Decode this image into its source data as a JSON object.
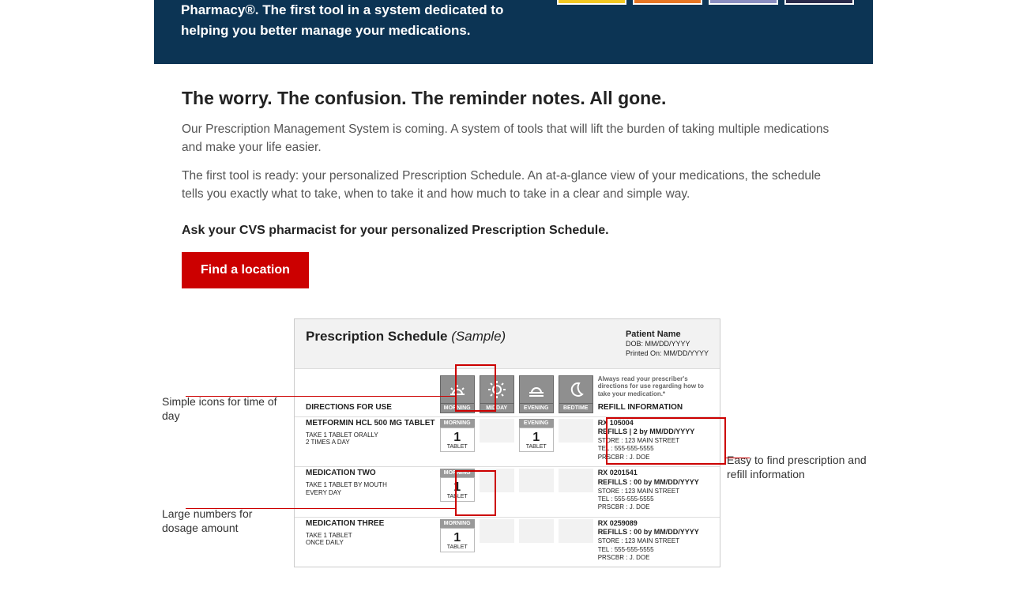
{
  "hero": {
    "text": "Pharmacy®. The first tool in a system dedicated to helping you better manage your medications."
  },
  "headline": "The worry. The confusion. The reminder notes. All gone.",
  "para1": "Our Prescription Management System is coming. A system of tools that will lift the burden of taking multiple medications and make your life easier.",
  "para2": "The first tool is ready: your personalized Prescription Schedule. An at-a-glance view of your medications, the schedule tells you exactly what to take, when to take it and how much to take in a clear and simple way.",
  "ask": "Ask your CVS pharmacist for your personalized Prescription Schedule.",
  "cta": "Find a location",
  "callouts": {
    "icons": "Simple icons for time of day",
    "numbers": "Large numbers for dosage amount",
    "refill": "Easy to find prescription and refill information"
  },
  "sample": {
    "title": "Prescription Schedule",
    "subtitle": "(Sample)",
    "patient": {
      "name": "Patient Name",
      "dob": "DOB: MM/DD/YYYY",
      "printed": "Printed On: MM/DD/YYYY"
    },
    "directions_header": "DIRECTIONS FOR USE",
    "refill_header": "REFILL INFORMATION",
    "refill_note": "Always read your prescriber's directions for use regarding how to take your medication.*",
    "tod": [
      "MORNING",
      "MIDDAY",
      "EVENING",
      "BEDTIME"
    ],
    "unit": "TABLET",
    "rows": [
      {
        "name": "METFORMIN HCL 500 MG TABLET",
        "dir": "TAKE 1 TABLET ORALLY\n2 TIMES A DAY",
        "cells": [
          "1",
          "",
          "1",
          ""
        ],
        "rx": {
          "num": "RX 105004",
          "refills": "REFILLS | 2 by MM/DD/YYYY",
          "store": "STORE : 123 MAIN STREET",
          "tel": "TEL : 555-555-5555",
          "prscbr": "PRSCBR : J. DOE"
        }
      },
      {
        "name": "MEDICATION TWO",
        "dir": "TAKE 1 TABLET BY MOUTH\nEVERY DAY",
        "cells": [
          "1",
          "",
          "",
          ""
        ],
        "rx": {
          "num": "RX 0201541",
          "refills": "REFILLS : 00 by MM/DD/YYYY",
          "store": "STORE : 123 MAIN STREET",
          "tel": "TEL : 555-555-5555",
          "prscbr": "PRSCBR : J. DOE"
        }
      },
      {
        "name": "MEDICATION THREE",
        "dir": "TAKE 1 TABLET\nONCE DAILY",
        "cells": [
          "1",
          "",
          "",
          ""
        ],
        "rx": {
          "num": "RX 0259089",
          "refills": "REFILLS : 00 by MM/DD/YYYY",
          "store": "STORE : 123 MAIN STREET",
          "tel": "TEL : 555-555-5555",
          "prscbr": "PRSCBR : J. DOE"
        }
      }
    ]
  }
}
